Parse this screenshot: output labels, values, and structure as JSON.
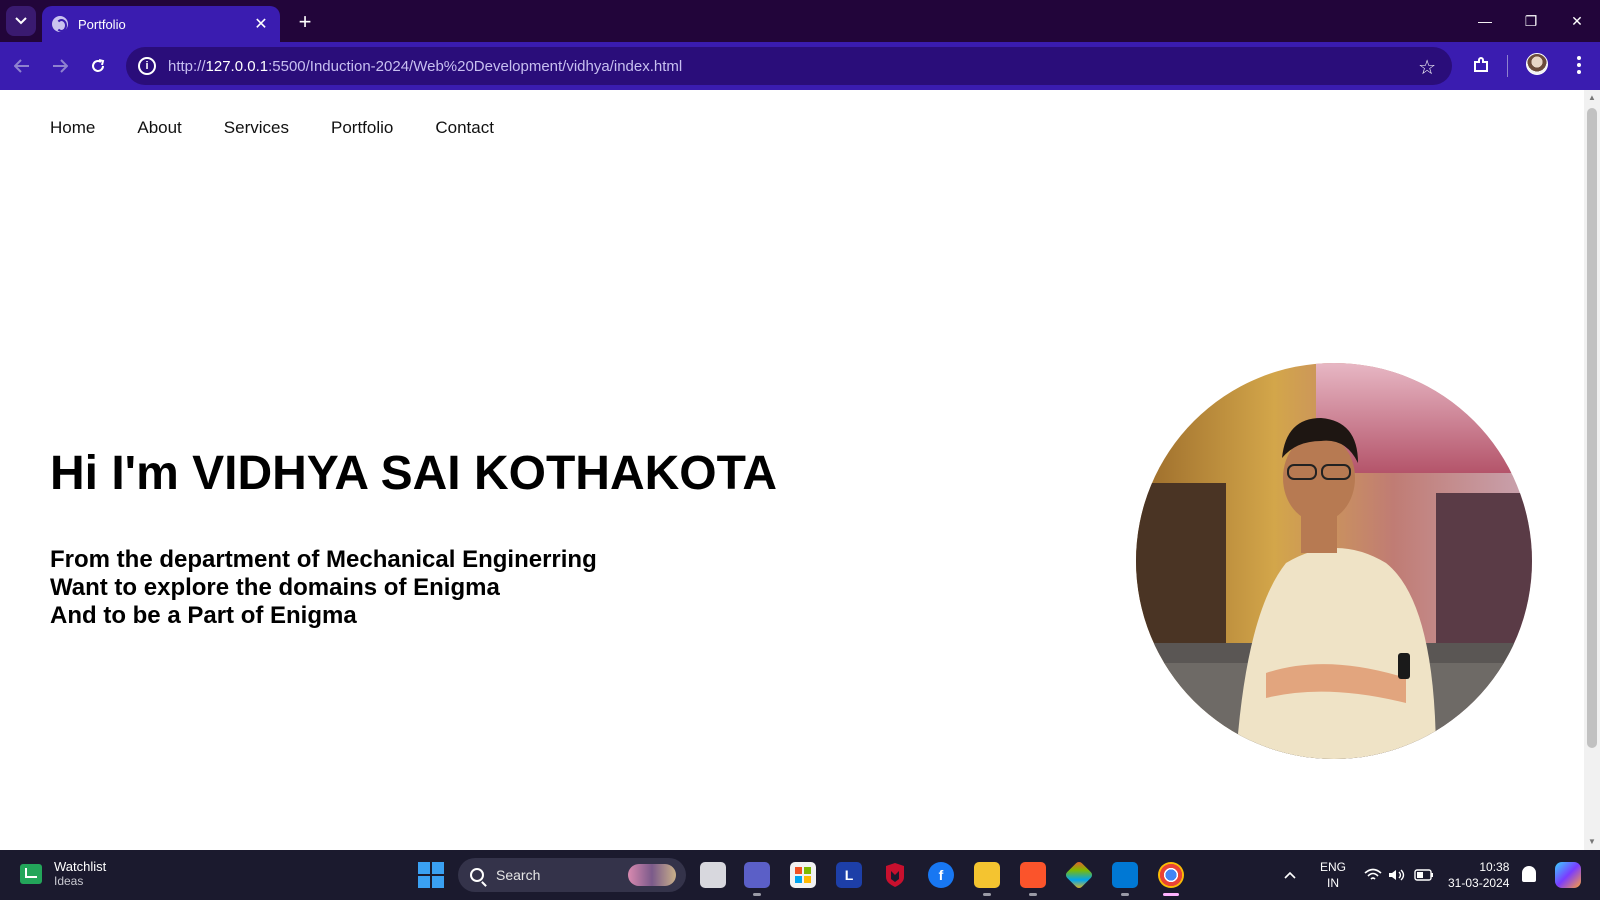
{
  "browser": {
    "tab_title": "Portfolio",
    "close_symbol": "✕",
    "new_tab_symbol": "+",
    "url_scheme": "http://",
    "url_host": "127.0.0.1",
    "url_rest": ":5500/Induction-2024/Web%20Development/vidhya/index.html",
    "window": {
      "minimize": "—",
      "restore": "❐",
      "close": "✕"
    }
  },
  "site": {
    "nav": [
      "Home",
      "About",
      "Services",
      "Portfolio",
      "Contact"
    ],
    "hero_title": "Hi I'm VIDHYA SAI KOTHAKOTA",
    "hero_lines": [
      "From the department of Mechanical Enginerring",
      "Want to explore the domains of Enigma",
      "And to be a Part of Enigma"
    ]
  },
  "taskbar": {
    "widget_title": "Watchlist",
    "widget_subtitle": "Ideas",
    "search_placeholder": "Search",
    "lang_top": "ENG",
    "lang_bottom": "IN",
    "time": "10:38",
    "date": "31-03-2024",
    "apps": [
      "file-explorer-icon",
      "teams-icon",
      "store-icon",
      "l-app-icon",
      "mcafee-icon",
      "facebook-icon",
      "folder-icon",
      "brave-icon",
      "git-icon",
      "vscode-icon",
      "chrome-icon"
    ],
    "app_glyphs": {
      "l_app": "L",
      "facebook": "f"
    }
  },
  "colors": {
    "tabbar": "#22053a",
    "toolbar": "#3a1cb0",
    "taskbar": "#1b1a2e"
  }
}
